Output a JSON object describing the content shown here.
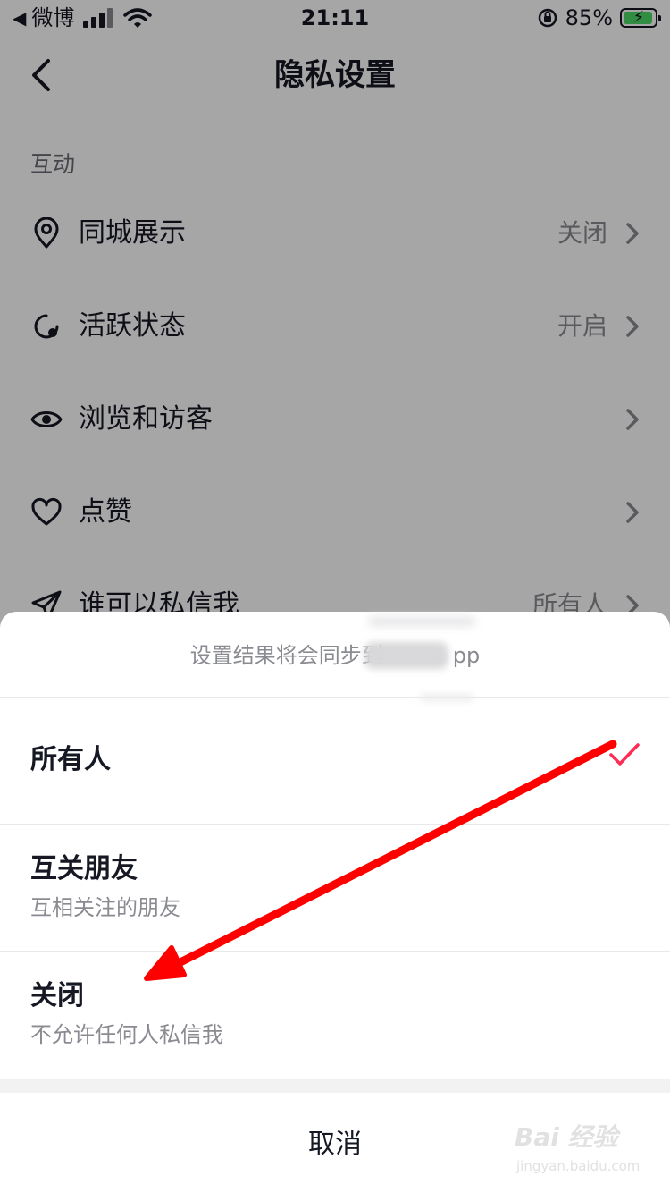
{
  "status_bar": {
    "back_glyph": "◀",
    "back_app": "微博",
    "time": "21:11",
    "battery_percent": "85%",
    "battery_level": 0.85,
    "accent_color": "#4cd964"
  },
  "nav": {
    "title": "隐私设置",
    "back_icon": "chevron-left-icon"
  },
  "section": {
    "title": "互动"
  },
  "rows": [
    {
      "label": "同城展示",
      "value": "关闭",
      "icon": "location-pin-icon"
    },
    {
      "label": "活跃状态",
      "value": "开启",
      "icon": "activity-status-icon"
    },
    {
      "label": "浏览和访客",
      "value": "",
      "icon": "eye-icon"
    },
    {
      "label": "点赞",
      "value": "",
      "icon": "heart-icon"
    },
    {
      "label": "谁可以私信我",
      "value": "所有人",
      "icon": "paper-plane-icon"
    }
  ],
  "sheet": {
    "header_prefix": "设置结果将会同步到",
    "header_suffix": "pp",
    "options": [
      {
        "title": "所有人",
        "subtitle": "",
        "selected": true
      },
      {
        "title": "互关朋友",
        "subtitle": "互相关注的朋友",
        "selected": false
      },
      {
        "title": "关闭",
        "subtitle": "不允许任何人私信我",
        "selected": false
      }
    ],
    "cancel_label": "取消",
    "check_color": "#fe2c55"
  },
  "annotation": {
    "arrow_color": "#ff0000"
  },
  "watermark": {
    "main": "Bai 经验",
    "sub": "jingyan.baidu.com"
  }
}
